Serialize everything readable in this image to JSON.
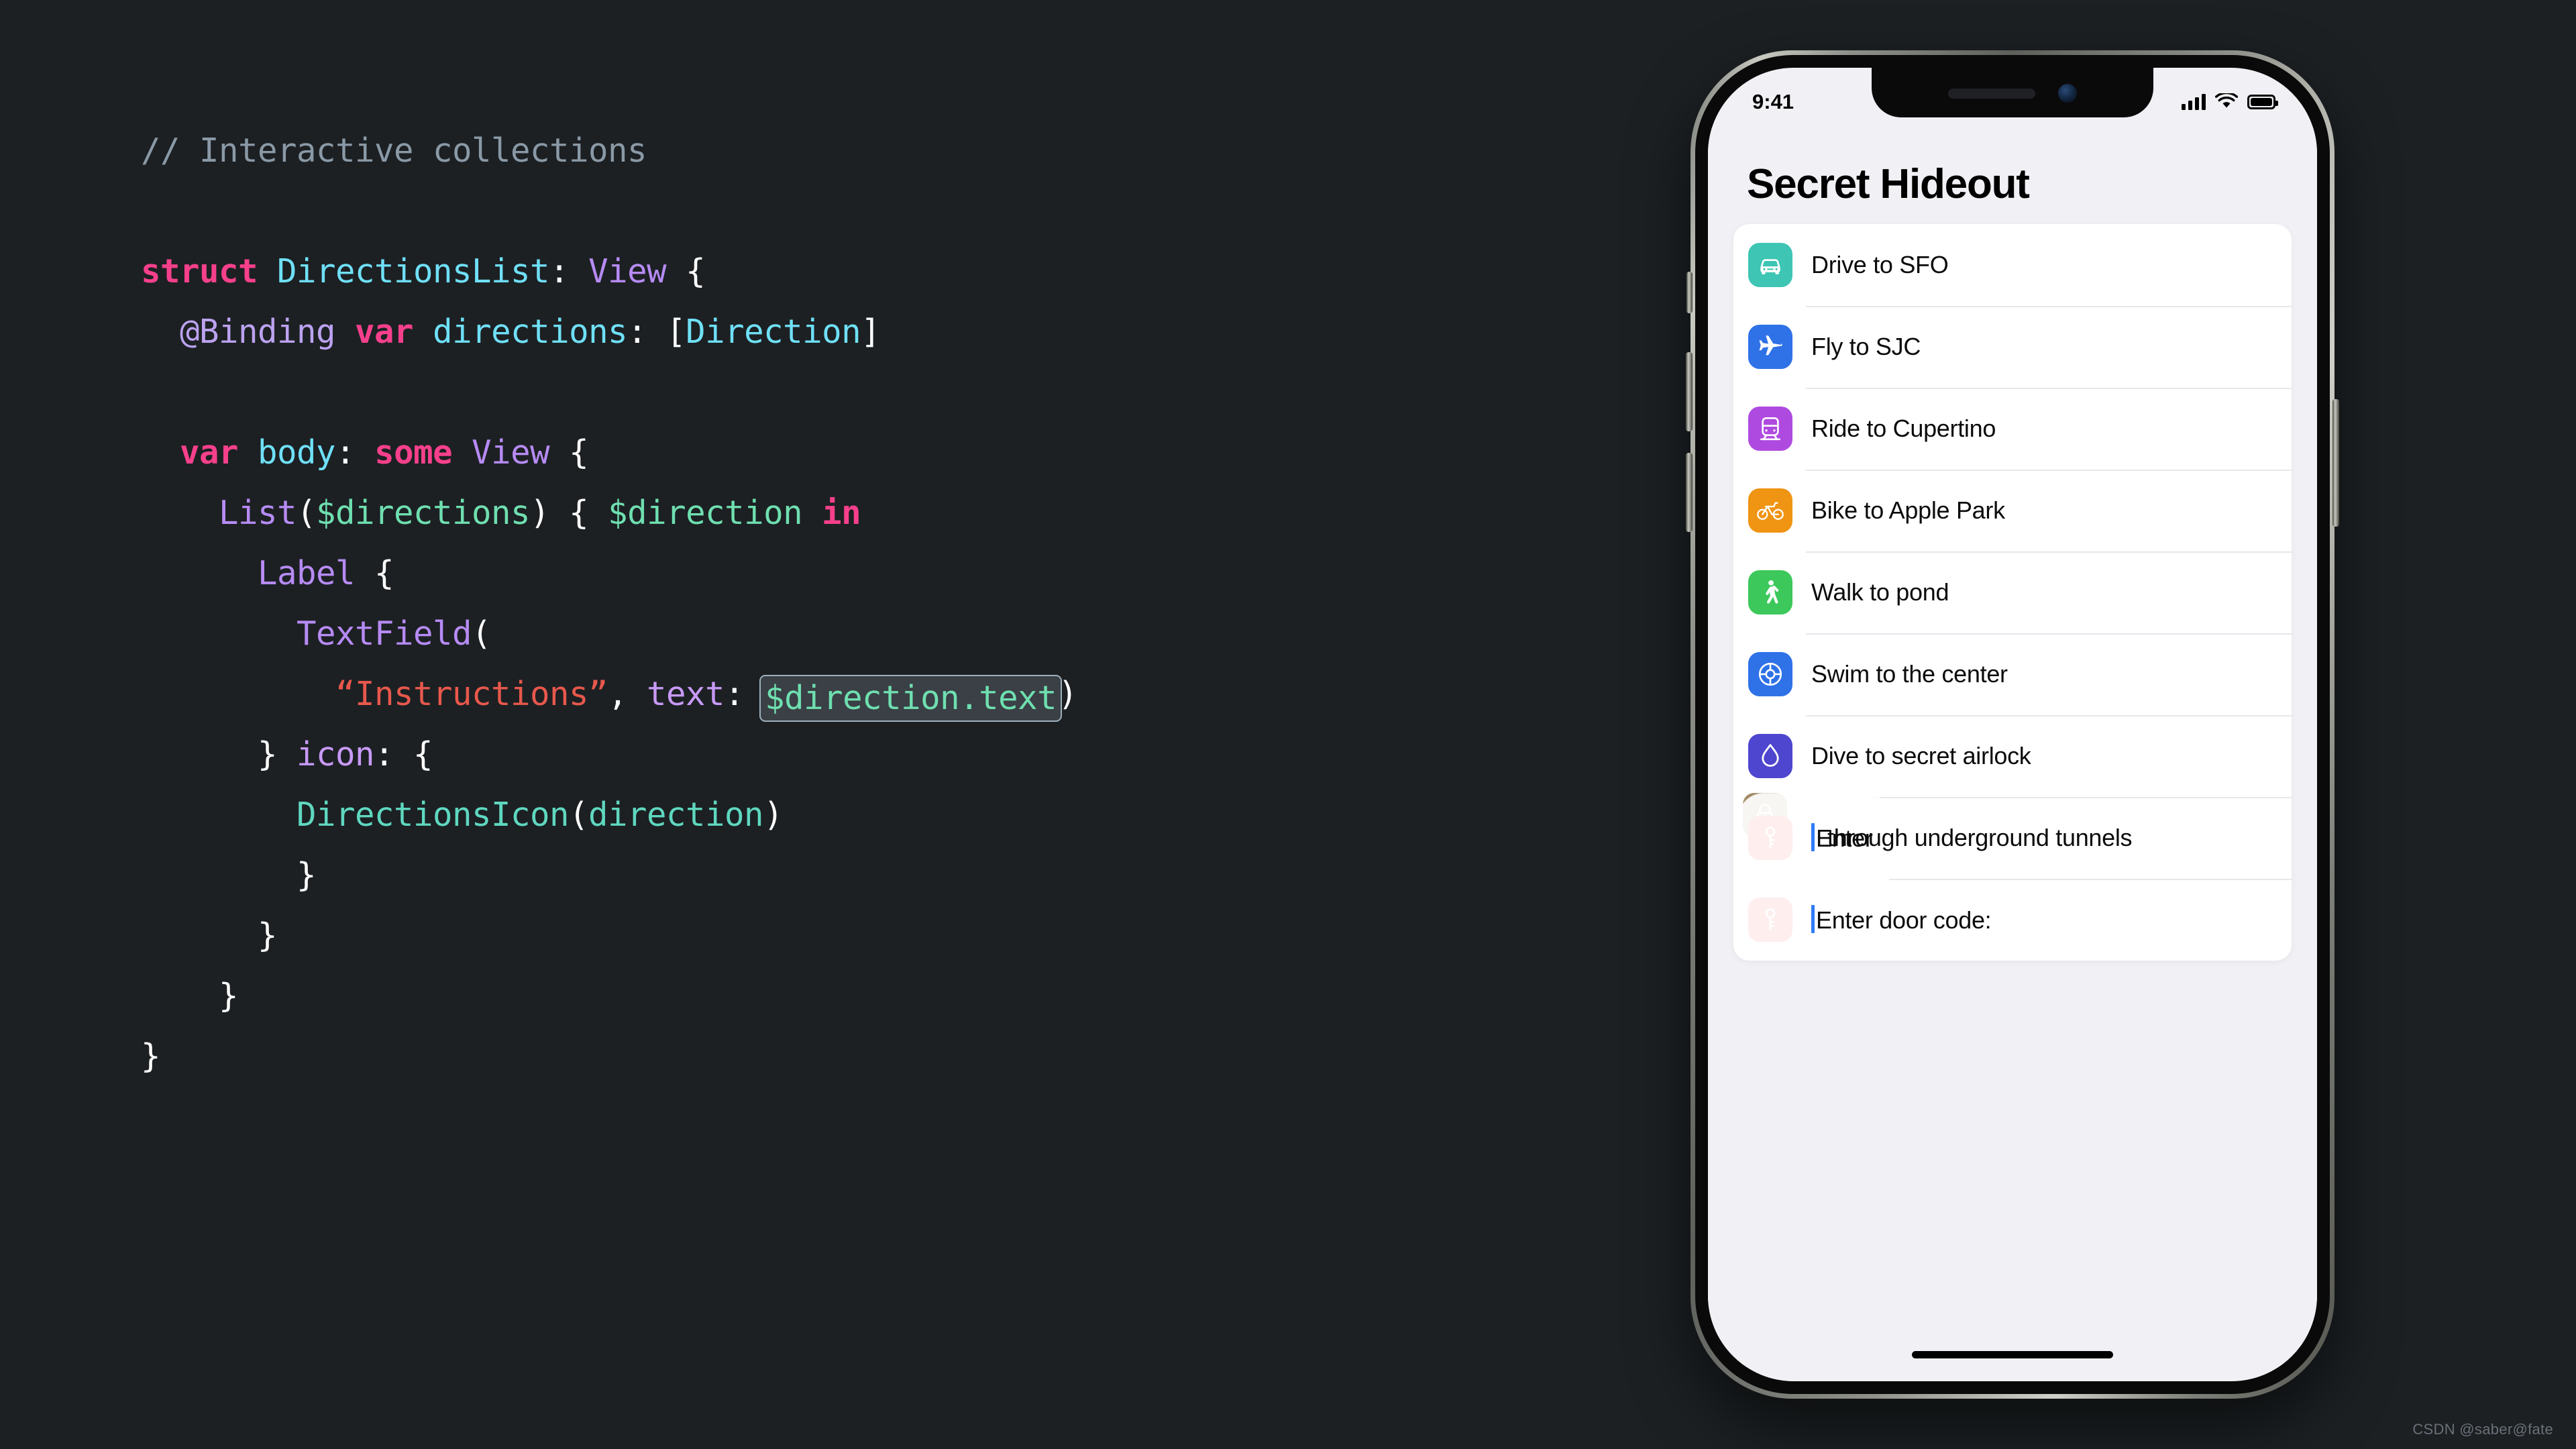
{
  "code": {
    "language": "Swift",
    "lines": [
      {
        "indent": 0,
        "tokens": [
          {
            "t": "// Interactive collections",
            "c": "cmt"
          }
        ]
      },
      {
        "indent": 0,
        "tokens": []
      },
      {
        "indent": 0,
        "tokens": [
          {
            "t": "struct",
            "c": "kw"
          },
          {
            "t": " ",
            "c": "pln"
          },
          {
            "t": "DirectionsList",
            "c": "typ"
          },
          {
            "t": ": ",
            "c": "pln"
          },
          {
            "t": "View",
            "c": "type2"
          },
          {
            "t": " {",
            "c": "pln"
          }
        ]
      },
      {
        "indent": 1,
        "tokens": [
          {
            "t": "@Binding",
            "c": "attr"
          },
          {
            "t": " ",
            "c": "pln"
          },
          {
            "t": "var",
            "c": "kw"
          },
          {
            "t": " ",
            "c": "pln"
          },
          {
            "t": "directions",
            "c": "typ"
          },
          {
            "t": ": [",
            "c": "pln"
          },
          {
            "t": "Direction",
            "c": "typ"
          },
          {
            "t": "]",
            "c": "pln"
          }
        ]
      },
      {
        "indent": 0,
        "tokens": []
      },
      {
        "indent": 1,
        "tokens": [
          {
            "t": "var",
            "c": "kw"
          },
          {
            "t": " ",
            "c": "pln"
          },
          {
            "t": "body",
            "c": "typ"
          },
          {
            "t": ": ",
            "c": "pln"
          },
          {
            "t": "some",
            "c": "kw"
          },
          {
            "t": " ",
            "c": "pln"
          },
          {
            "t": "View",
            "c": "type2"
          },
          {
            "t": " {",
            "c": "pln"
          }
        ]
      },
      {
        "indent": 2,
        "tokens": [
          {
            "t": "List",
            "c": "type2"
          },
          {
            "t": "(",
            "c": "pln"
          },
          {
            "t": "$directions",
            "c": "bind"
          },
          {
            "t": ") { ",
            "c": "pln"
          },
          {
            "t": "$direction",
            "c": "bind"
          },
          {
            "t": " ",
            "c": "pln"
          },
          {
            "t": "in",
            "c": "kw"
          }
        ]
      },
      {
        "indent": 3,
        "tokens": [
          {
            "t": "Label",
            "c": "type2"
          },
          {
            "t": " {",
            "c": "pln"
          }
        ]
      },
      {
        "indent": 4,
        "tokens": [
          {
            "t": "TextField",
            "c": "type2"
          },
          {
            "t": "(",
            "c": "pln"
          }
        ]
      },
      {
        "indent": 5,
        "tokens": [
          {
            "t": "“Instructions”",
            "c": "str"
          },
          {
            "t": ", ",
            "c": "pln"
          },
          {
            "t": "text",
            "c": "prop"
          },
          {
            "t": ": ",
            "c": "pln"
          },
          {
            "t": "$direction.text",
            "c": "bind",
            "boxed": true
          },
          {
            "t": ")",
            "c": "pln"
          }
        ]
      },
      {
        "indent": 3,
        "tokens": [
          {
            "t": "} ",
            "c": "pln"
          },
          {
            "t": "icon",
            "c": "prop"
          },
          {
            "t": ": {",
            "c": "pln"
          }
        ]
      },
      {
        "indent": 4,
        "tokens": [
          {
            "t": "DirectionsIcon",
            "c": "mem"
          },
          {
            "t": "(",
            "c": "pln"
          },
          {
            "t": "direction",
            "c": "mem"
          },
          {
            "t": ")",
            "c": "pln"
          }
        ]
      },
      {
        "indent": 4,
        "tokens": [
          {
            "t": "}",
            "c": "pln"
          }
        ]
      },
      {
        "indent": 3,
        "tokens": [
          {
            "t": "}",
            "c": "pln"
          }
        ]
      },
      {
        "indent": 2,
        "tokens": [
          {
            "t": "}",
            "c": "pln"
          }
        ]
      },
      {
        "indent": 0,
        "tokens": [
          {
            "t": "}",
            "c": "pln"
          }
        ]
      }
    ]
  },
  "phone": {
    "status_bar": {
      "time": "9:41",
      "cellular_icon": "signal-bars-icon",
      "wifi_icon": "wifi-icon",
      "battery_icon": "battery-icon"
    },
    "nav": {
      "title": "Secret Hideout"
    },
    "list": {
      "rows": [
        {
          "icon": "car-icon",
          "icon_color": "#3EC5B4",
          "label": "Drive to SFO"
        },
        {
          "icon": "airplane-icon",
          "icon_color": "#2F72E8",
          "label": "Fly to SJC"
        },
        {
          "icon": "tram-icon",
          "icon_color": "#AF4AE0",
          "label": "Ride to Cupertino"
        },
        {
          "icon": "bicycle-icon",
          "icon_color": "#F09413",
          "label": "Bike to Apple Park"
        },
        {
          "icon": "walk-icon",
          "icon_color": "#3CC85A",
          "label": "Walk to pond"
        },
        {
          "icon": "life-preserver-icon",
          "icon_color": "#2F72E8",
          "label": "Swim to the center"
        },
        {
          "icon": "water-drop-icon",
          "icon_color": "#4E46CE",
          "label": "Dive to secret airlock"
        },
        {
          "icon": "key-icon",
          "icon_color": "#F03028",
          "label": "Enter",
          "ghost_icon": "lock-icon",
          "ghost_icon_color": "#A08964",
          "ghost_label": "through underground tunnels",
          "editing": true
        },
        {
          "icon": "key-icon",
          "icon_color": "#F03028",
          "label": "Enter door code:",
          "editing": true
        }
      ]
    },
    "home_indicator": "home-indicator"
  },
  "watermark": {
    "text": "CSDN @saber@fate"
  }
}
